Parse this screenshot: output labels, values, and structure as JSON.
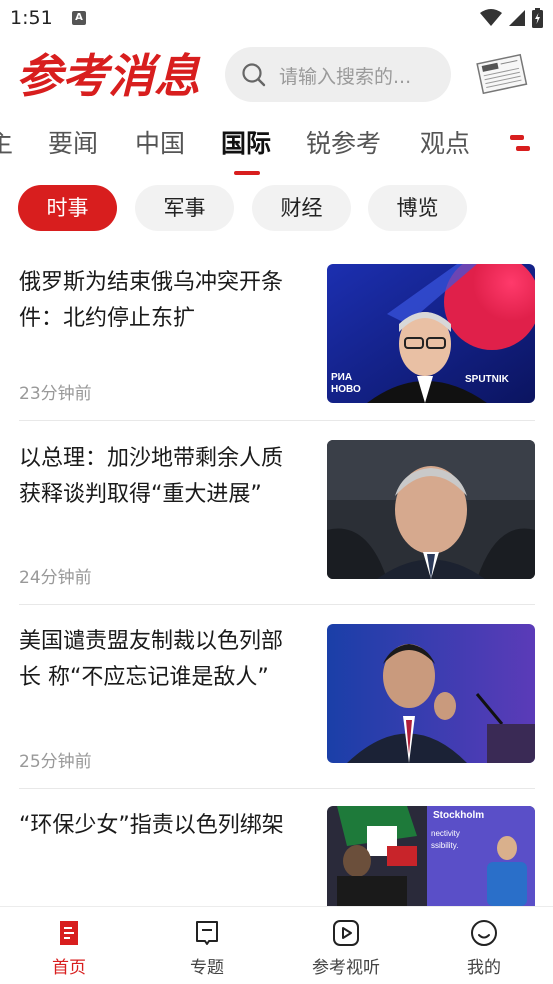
{
  "status_bar": {
    "time": "1:51"
  },
  "header": {
    "logo_text": "参考消息",
    "search_placeholder": "请输入搜索的..."
  },
  "category_tabs": [
    {
      "label": "主"
    },
    {
      "label": "要闻"
    },
    {
      "label": "中国"
    },
    {
      "label": "国际",
      "active": true
    },
    {
      "label": "锐参考"
    },
    {
      "label": "观点"
    }
  ],
  "sub_tabs": [
    {
      "label": "时事",
      "active": true
    },
    {
      "label": "军事"
    },
    {
      "label": "财经"
    },
    {
      "label": "博览"
    }
  ],
  "news": [
    {
      "title": "俄罗斯为结束俄乌冲突开条件：北约停止东扩",
      "time": "23分钟前",
      "thumb_overlay_left": "РИА НОВО",
      "thumb_overlay_right": "SPUTNIK"
    },
    {
      "title": "以总理：加沙地带剩余人质获释谈判取得“重大进展”",
      "time": "24分钟前"
    },
    {
      "title": "美国谴责盟友制裁以色列部长  称“不应忘记谁是敌人”",
      "time": "25分钟前"
    },
    {
      "title": "“环保少女”指责以色列绑架",
      "thumb_overlay_text": "Stockholm",
      "thumb_overlay_sub": "nectivity ssibility."
    }
  ],
  "bottom_nav": [
    {
      "label": "首页",
      "active": true
    },
    {
      "label": "专题"
    },
    {
      "label": "参考视听"
    },
    {
      "label": "我的"
    }
  ],
  "colors": {
    "brand_red": "#d81e1e"
  }
}
